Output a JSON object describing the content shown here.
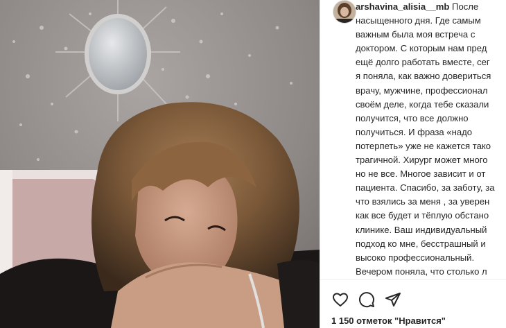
{
  "post": {
    "username": "arshavina_alisia__mb",
    "caption_first": "После",
    "caption_lines": [
      "насыщенного дня. Где самым",
      "важным была моя встреча с",
      "доктором. С которым нам пред",
      "ещё долго работать вместе, сег",
      "я поняла, как важно довериться",
      "врачу, мужчине, профессионал",
      "своём деле, когда тебе сказали",
      "получится, что все должно",
      "получиться. И фраза «надо",
      "потерпеть» уже не кажется тако",
      "трагичной. Хирург может много",
      "но не все. Многое зависит и от",
      "пациента. Спасибо, за заботу, за",
      "что взялись за меня , за уверен",
      "как все будет и тёплую обстано",
      "клинике. Ваш индивидуальный",
      "подход ко мне, бесстрашный и",
      "высоко профессиональный.",
      "Вечером поняла, что столько л"
    ],
    "likes_text": "1 150 отметок \"Нравится\""
  },
  "icons": {
    "like": "heart-icon",
    "comment": "comment-icon",
    "share": "paper-plane-icon"
  },
  "colors": {
    "text": "#262626",
    "border": "#efefef"
  }
}
